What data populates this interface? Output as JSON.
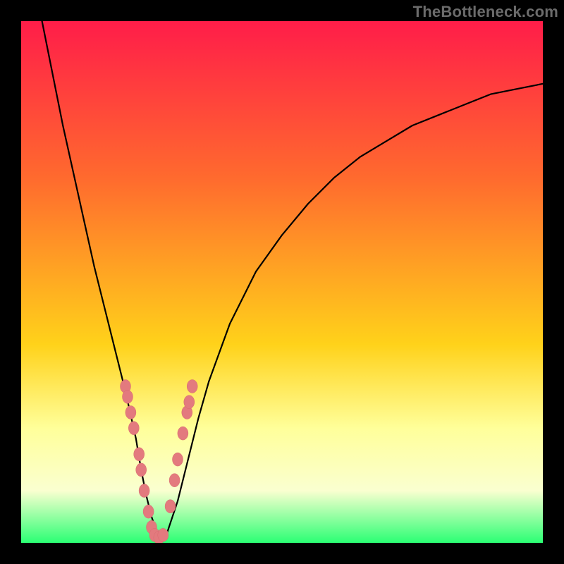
{
  "watermark": {
    "text": "TheBottleneck.com"
  },
  "palette": {
    "background": "#000000",
    "gradient_top": "#ff1d49",
    "gradient_upper_mid": "#ff6a2e",
    "gradient_mid": "#ffd21a",
    "gradient_light_band_top": "#ffff9a",
    "gradient_light_band_bottom": "#faffd0",
    "gradient_bottom": "#2bff74",
    "curve_stroke": "#000000",
    "marker_fill": "#e37a7e",
    "marker_stroke": "#d86a6e"
  },
  "chart_data": {
    "type": "line",
    "title": "",
    "xlabel": "",
    "ylabel": "",
    "xlim": [
      0,
      100
    ],
    "ylim": [
      0,
      100
    ],
    "grid": false,
    "legend": false,
    "notes": "No axis tick labels present. Values are estimated from pixel position on the plot area (origin bottom-left, 0–100 range each axis). The plot shows a V-shaped bottleneck curve with a cluster of sample points near the minimum.",
    "series": [
      {
        "name": "bottleneck-curve",
        "x": [
          4,
          6,
          8,
          10,
          12,
          14,
          16,
          18,
          20,
          22,
          23,
          24,
          25,
          26,
          27,
          28,
          30,
          32,
          34,
          36,
          40,
          45,
          50,
          55,
          60,
          65,
          70,
          75,
          80,
          85,
          90,
          95,
          100
        ],
        "y": [
          100,
          90,
          80,
          71,
          62,
          53,
          45,
          37,
          29,
          20,
          14,
          9,
          5,
          2,
          1,
          2,
          8,
          16,
          24,
          31,
          42,
          52,
          59,
          65,
          70,
          74,
          77,
          80,
          82,
          84,
          86,
          87,
          88
        ]
      }
    ],
    "scatter": {
      "name": "sample-points",
      "points": [
        {
          "x": 20.0,
          "y": 30
        },
        {
          "x": 20.4,
          "y": 28
        },
        {
          "x": 21.0,
          "y": 25
        },
        {
          "x": 21.6,
          "y": 22
        },
        {
          "x": 22.6,
          "y": 17
        },
        {
          "x": 23.0,
          "y": 14
        },
        {
          "x": 23.6,
          "y": 10
        },
        {
          "x": 24.4,
          "y": 6
        },
        {
          "x": 25.0,
          "y": 3
        },
        {
          "x": 25.6,
          "y": 1.5
        },
        {
          "x": 26.4,
          "y": 1
        },
        {
          "x": 27.2,
          "y": 1.5
        },
        {
          "x": 28.6,
          "y": 7
        },
        {
          "x": 29.4,
          "y": 12
        },
        {
          "x": 30.0,
          "y": 16
        },
        {
          "x": 31.0,
          "y": 21
        },
        {
          "x": 31.8,
          "y": 25
        },
        {
          "x": 32.2,
          "y": 27
        },
        {
          "x": 32.8,
          "y": 30
        }
      ]
    }
  }
}
